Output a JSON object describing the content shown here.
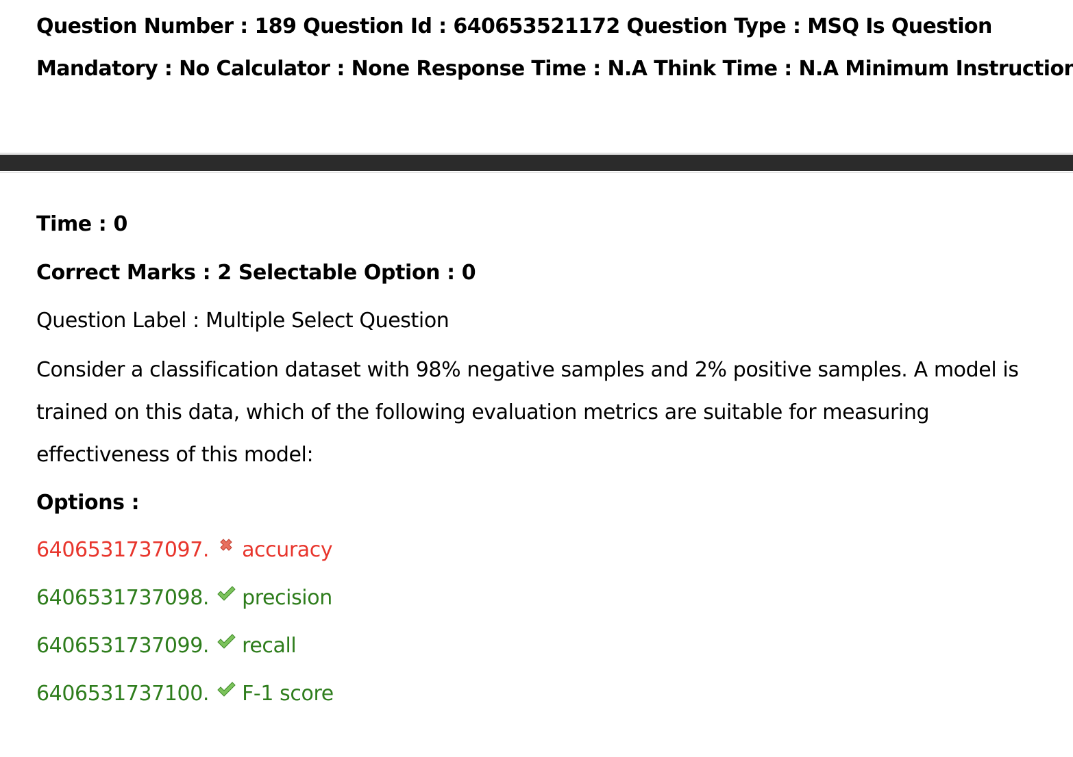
{
  "header": {
    "line1": "Question Number : 189 Question Id : 640653521172 Question Type : MSQ Is Question",
    "line2": "Mandatory : No Calculator : None Response Time : N.A Think Time : N.A Minimum Instruction"
  },
  "question": {
    "time": "Time : 0",
    "marks": "Correct Marks : 2 Selectable Option : 0",
    "label": "Question Label : Multiple Select Question",
    "text": "Consider a classification dataset with 98% negative samples and 2% positive samples. A model is trained on this data, which of the following evaluation metrics are suitable for measuring effectiveness of this model:",
    "options_heading": "Options :"
  },
  "options": [
    {
      "id": "6406531737097.",
      "text": "accuracy",
      "status": "wrong",
      "icon": "cross-icon",
      "color": "#e8352c"
    },
    {
      "id": "6406531737098.",
      "text": "precision",
      "status": "correct",
      "icon": "check-icon",
      "color": "#2e7d1c"
    },
    {
      "id": "6406531737099.",
      "text": "recall",
      "status": "correct",
      "icon": "check-icon",
      "color": "#2e7d1c"
    },
    {
      "id": "6406531737100.",
      "text": "F-1 score",
      "status": "correct",
      "icon": "check-icon",
      "color": "#2e7d1c"
    }
  ]
}
